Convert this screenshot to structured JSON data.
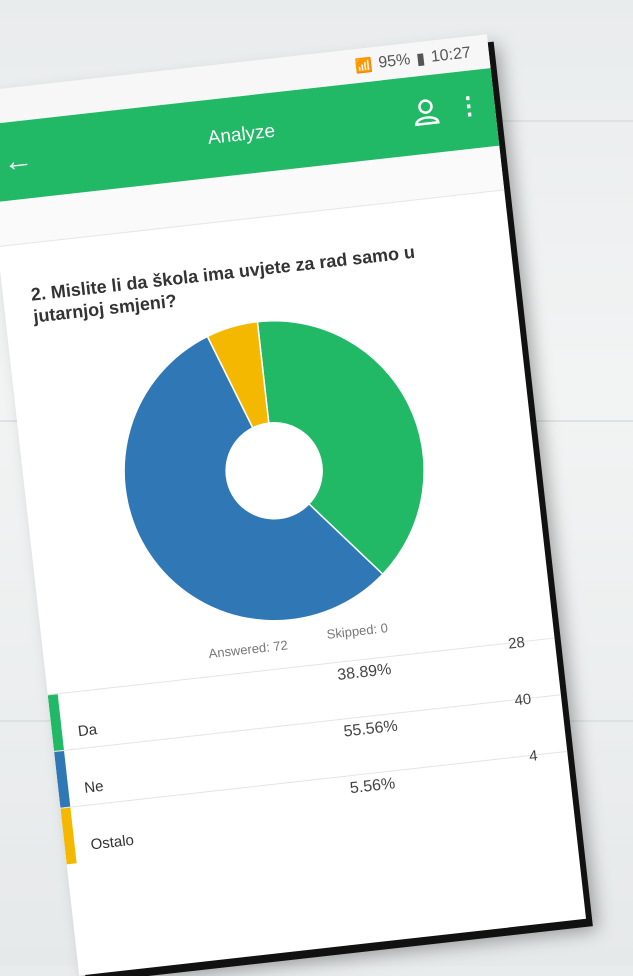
{
  "status": {
    "battery": "95%",
    "time": "10:27"
  },
  "appbar": {
    "title": "Analyze"
  },
  "question": {
    "text": "2. Mislite li da škola ima uvjete za rad samo u jutarnjoj smjeni?"
  },
  "summary": {
    "answered": "Answered: 72",
    "skipped": "Skipped: 0"
  },
  "colors": {
    "green": "#21b866",
    "blue": "#2f78b5",
    "yellow": "#f5b800",
    "accent": "#21b866"
  },
  "chart_data": {
    "type": "pie",
    "categories": [
      "Da",
      "Ne",
      "Ostalo"
    ],
    "values": [
      28,
      40,
      4
    ],
    "colors": [
      "#21b866",
      "#2f78b5",
      "#f5b800"
    ]
  },
  "rows": [
    {
      "label": "Da",
      "percent": "38.89%",
      "count": "28",
      "color": "#21b866"
    },
    {
      "label": "Ne",
      "percent": "55.56%",
      "count": "40",
      "color": "#2f78b5"
    },
    {
      "label": "Ostalo",
      "percent": "5.56%",
      "count": "4",
      "color": "#f5b800"
    }
  ],
  "icons": {
    "back": "back-arrow-icon",
    "user": "user-icon",
    "more": "more-vert-icon"
  }
}
